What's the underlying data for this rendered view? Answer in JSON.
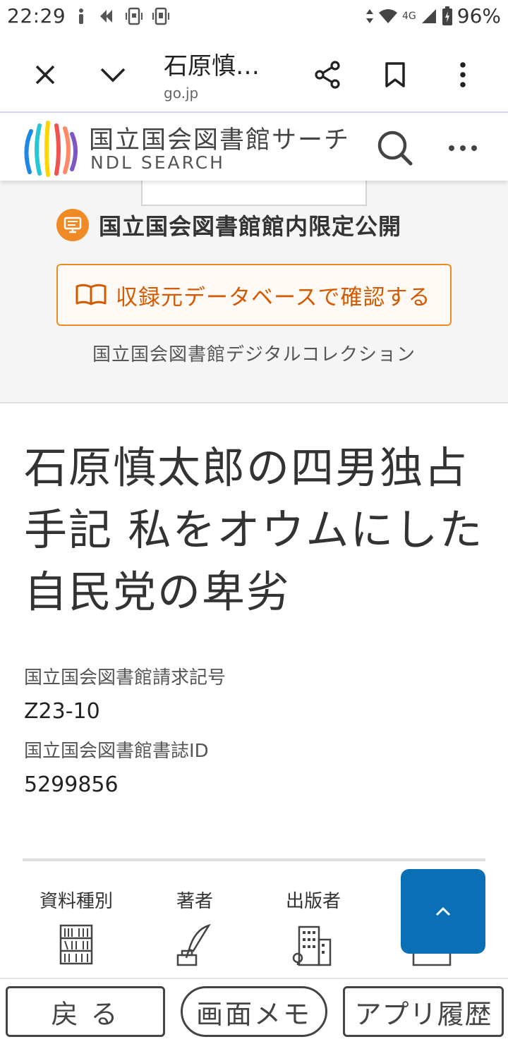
{
  "status_bar": {
    "time": "22:29",
    "network": "4G",
    "battery": "96%"
  },
  "browser": {
    "tab_title": "石原慎…",
    "url": "go.jp"
  },
  "site": {
    "logo_jp": "国立国会図書館サーチ",
    "logo_en": "NDL SEARCH"
  },
  "access": {
    "limited_label": "国立国会図書館館内限定公開",
    "source_button": "収録元データベースで確認する",
    "collection": "国立国会図書館デジタルコレクション",
    "accent_color": "#f08a24"
  },
  "record": {
    "title": "石原慎太郎の四男独占手記 私をオウムにした自民党の卑劣",
    "call_number_label": "国立国会図書館請求記号",
    "call_number": "Z23-10",
    "bib_id_label": "国立国会図書館書誌ID",
    "bib_id": "5299856"
  },
  "facets": [
    {
      "label": "資料種別",
      "icon": "bookshelf-icon"
    },
    {
      "label": "著者",
      "icon": "quill-pen-icon"
    },
    {
      "label": "出版者",
      "icon": "buildings-icon"
    },
    {
      "label": "",
      "icon": "calendar-icon"
    }
  ],
  "bottom_bar": {
    "back": "戻 る",
    "memo": "画面メモ",
    "history": "アプリ履歴"
  },
  "colors": {
    "scroll_top": "#0a70b5",
    "source_text": "#d35a00"
  }
}
